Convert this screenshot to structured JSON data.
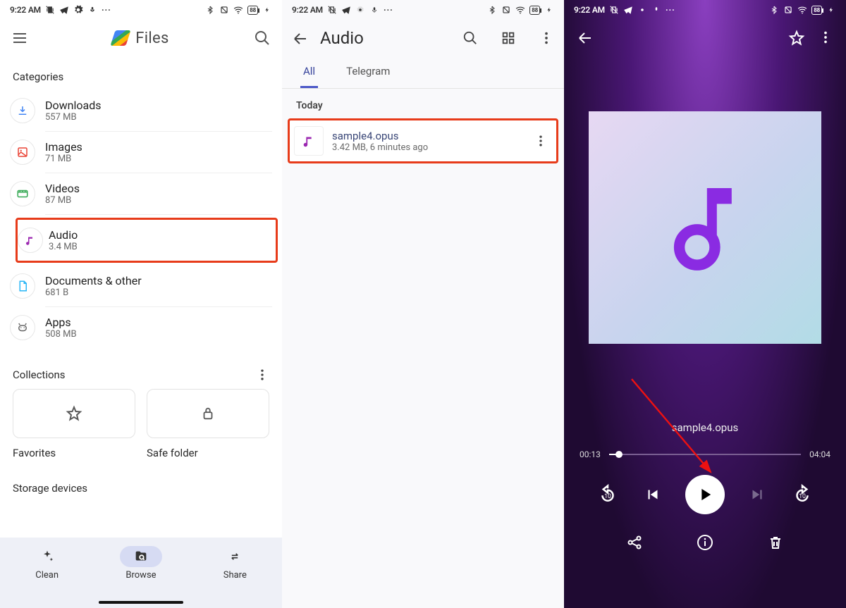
{
  "statusbar": {
    "time": "9:22 AM",
    "battery_label": "88"
  },
  "screen1": {
    "app_name": "Files",
    "section_categories": "Categories",
    "categories": [
      {
        "title": "Downloads",
        "sub": "557 MB"
      },
      {
        "title": "Images",
        "sub": "71 MB"
      },
      {
        "title": "Videos",
        "sub": "87 MB"
      },
      {
        "title": "Audio",
        "sub": "3.4 MB"
      },
      {
        "title": "Documents & other",
        "sub": "681 B"
      },
      {
        "title": "Apps",
        "sub": "508 MB"
      }
    ],
    "section_collections": "Collections",
    "favorites_label": "Favorites",
    "safefolder_label": "Safe folder",
    "section_storage": "Storage devices",
    "bottom_tabs": {
      "clean": "Clean",
      "browse": "Browse",
      "share": "Share"
    }
  },
  "screen2": {
    "title": "Audio",
    "tabs": {
      "all": "All",
      "telegram": "Telegram"
    },
    "day_header": "Today",
    "file": {
      "name": "sample4.opus",
      "meta": "3.42 MB, 6 minutes ago"
    }
  },
  "screen3": {
    "track": "sample4.opus",
    "elapsed": "00:13",
    "duration": "04:04"
  }
}
